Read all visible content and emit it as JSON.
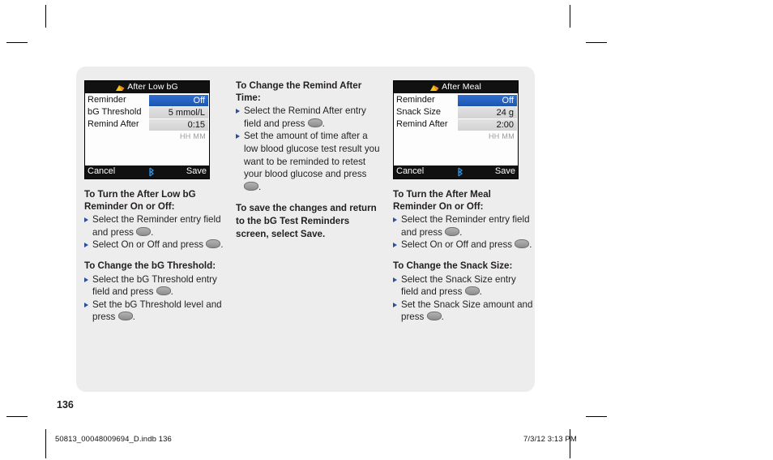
{
  "page": {
    "number": "136",
    "footer_file": "50813_00048009694_D.indb   136",
    "footer_date": "7/3/12   3:13 PM"
  },
  "left_column": {
    "device": {
      "title": "After Low bG",
      "title_icon": "low-bg-flag-icon",
      "rows": [
        {
          "label": "Reminder",
          "value": "Off",
          "selected": true,
          "units": ""
        },
        {
          "label": "bG Threshold",
          "value": "5 mmol/L",
          "selected": false,
          "units": ""
        },
        {
          "label": "Remind After",
          "value": "0:15",
          "selected": false,
          "units": "HH MM"
        }
      ],
      "cancel_label": "Cancel",
      "save_label": "Save",
      "status_icon": "bluetooth-icon"
    },
    "section1": {
      "heading": "To Turn the After Low bG Reminder On or Off:",
      "bullets": [
        {
          "pre": "Select the Reminder entry field and press ",
          "button": true,
          "post": "."
        },
        {
          "pre": "Select On or Off and press ",
          "button": true,
          "post": "."
        }
      ]
    },
    "section2": {
      "heading": "To Change the bG Threshold:",
      "bullets": [
        {
          "pre": "Select the bG Threshold entry field and press ",
          "button": true,
          "post": "."
        },
        {
          "pre": "Set the bG Threshold level and press ",
          "button": true,
          "post": "."
        }
      ]
    }
  },
  "middle_column": {
    "section1": {
      "heading": "To Change the Remind After Time:",
      "bullets": [
        {
          "pre": "Select the Remind After entry field and press ",
          "button": true,
          "post": "."
        },
        {
          "pre": "Set the amount of time after a low blood glucose test result you want to be reminded to retest your blood glucose and press ",
          "button": true,
          "post": "."
        }
      ]
    },
    "paragraph": "To save the changes and return to the bG Test Reminders screen, select Save."
  },
  "right_column": {
    "device": {
      "title": "After Meal",
      "title_icon": "after-meal-flag-icon",
      "rows": [
        {
          "label": "Reminder",
          "value": "Off",
          "selected": true,
          "units": ""
        },
        {
          "label": "Snack Size",
          "value": "24 g",
          "selected": false,
          "units": ""
        },
        {
          "label": "Remind After",
          "value": "2:00",
          "selected": false,
          "units": "HH MM"
        }
      ],
      "cancel_label": "Cancel",
      "save_label": "Save",
      "status_icon": "bluetooth-icon"
    },
    "section1": {
      "heading": "To Turn the After Meal Reminder On or Off:",
      "bullets": [
        {
          "pre": "Select the Reminder entry field and press ",
          "button": true,
          "post": "."
        },
        {
          "pre": "Select On or Off and press ",
          "button": true,
          "post": "."
        }
      ]
    },
    "section2": {
      "heading": "To Change the Snack Size:",
      "bullets": [
        {
          "pre": "Select the Snack Size entry field and press ",
          "button": true,
          "post": "."
        },
        {
          "pre": "Set the Snack Size amount and press ",
          "button": true,
          "post": "."
        }
      ]
    }
  },
  "colors": {
    "selection_blue": "#2f6fd0",
    "bullet_blue": "#2b4f9e",
    "panel_gray": "#ededed",
    "device_bar_black": "#111111",
    "icon_yellow": "#f5c518",
    "bluetooth_blue": "#2e8ad6"
  }
}
